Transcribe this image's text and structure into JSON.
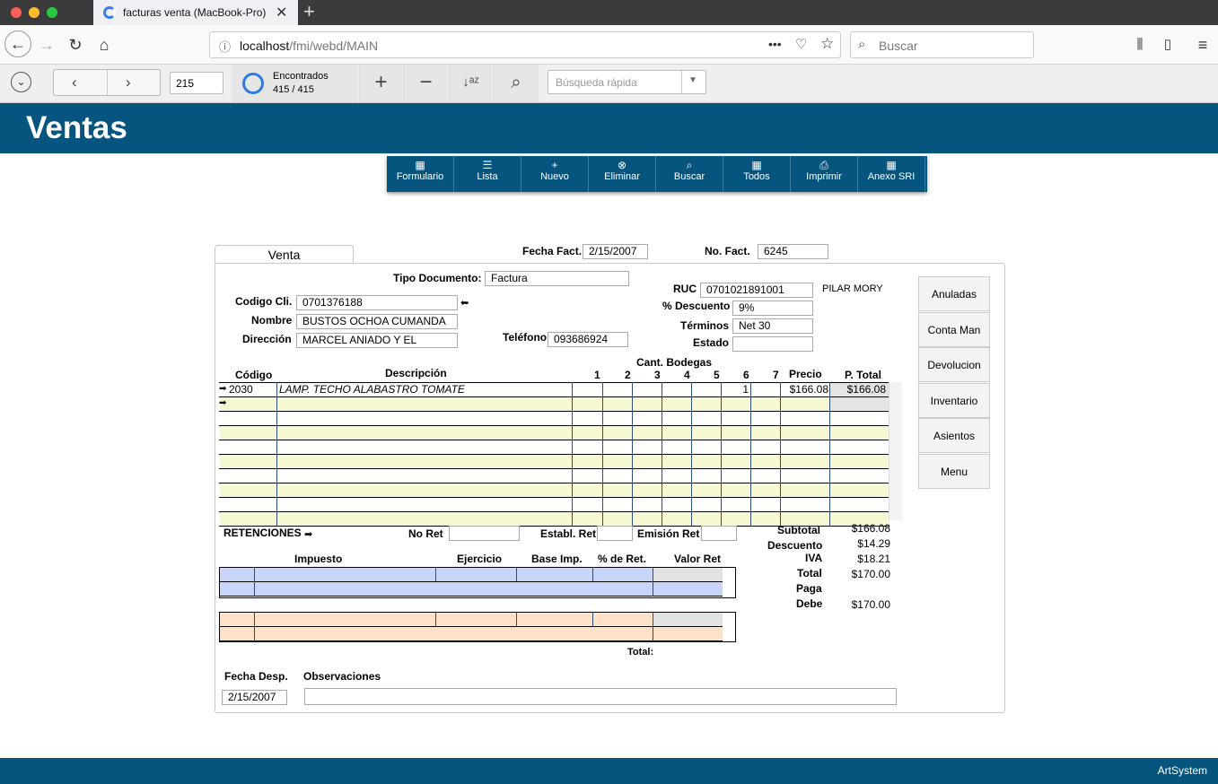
{
  "browser": {
    "tab_title": "facturas venta (MacBook-Pro)",
    "url_host": "localhost",
    "url_path": "/fmi/webd/MAIN",
    "search_placeholder": "Buscar"
  },
  "fm_toolbar": {
    "record_number": "215",
    "found_label": "Encontrados",
    "found_count": "415 / 415",
    "quick_search_placeholder": "Búsqueda rápida"
  },
  "header": {
    "title": "Ventas"
  },
  "footer": {
    "brand": "ArtSystem"
  },
  "actions": [
    {
      "label": "Formulario",
      "icon": "▦"
    },
    {
      "label": "Lista",
      "icon": "☰"
    },
    {
      "label": "Nuevo",
      "icon": "+"
    },
    {
      "label": "Eliminar",
      "icon": "⊗"
    },
    {
      "label": "Buscar",
      "icon": "⌕"
    },
    {
      "label": "Todos",
      "icon": "▦"
    },
    {
      "label": "Imprimir",
      "icon": "⎙"
    },
    {
      "label": "Anexo SRI",
      "icon": "▦"
    }
  ],
  "form": {
    "tab_label": "Venta",
    "fecha_fact_label": "Fecha Fact.",
    "fecha_fact": "2/15/2007",
    "no_fact_label": "No. Fact.",
    "no_fact": "6245",
    "tipo_doc_label": "Tipo Documento:",
    "tipo_doc": "Factura",
    "codigo_cli_label": "Codigo Cli.",
    "codigo_cli": "0701376188",
    "nombre_label": "Nombre",
    "nombre": "BUSTOS OCHOA CUMANDA",
    "direccion_label": "Dirección",
    "direccion": "MARCEL ANIADO Y EL",
    "telefono_label": "Teléfono",
    "telefono": "093686924",
    "ruc_label": "RUC",
    "ruc": "0701021891001",
    "vendedor": "PILAR MORY",
    "descuento_label": "% Descuento",
    "descuento": "9%",
    "terminos_label": "Términos",
    "terminos": "Net 30",
    "estado_label": "Estado",
    "estado": ""
  },
  "side_buttons": [
    "Anuladas",
    "Conta Man",
    "Devolucion",
    "Inventario",
    "Asientos",
    "Menu"
  ],
  "items_header": {
    "codigo": "Código",
    "descripcion": "Descripción",
    "bodegas": "Cant. Bodegas",
    "cols": [
      "1",
      "2",
      "3",
      "4",
      "5",
      "6",
      "7"
    ],
    "precio": "Precio",
    "ptotal": "P. Total"
  },
  "items": [
    {
      "codigo": "2030",
      "descripcion": "LAMP. TECHO ALABASTRO TOMATE",
      "bodega6": "1",
      "precio": "$166.08",
      "total": "$166.08"
    }
  ],
  "retenciones": {
    "title": "RETENCIONES",
    "no_ret_label": "No  Ret",
    "establ_label": "Establ. Ret",
    "emision_label": "Emisión Ret",
    "cols": [
      "Impuesto",
      "Ejercicio",
      "Base Imp.",
      "% de Ret.",
      "Valor Ret"
    ],
    "total_label": "Total:"
  },
  "totals": {
    "subtotal_label": "Subtotal",
    "subtotal": "$166.08",
    "descuento_label": "Descuento",
    "descuento": "$14.29",
    "iva_label": "IVA",
    "iva": "$18.21",
    "total_label": "Total",
    "total": "$170.00",
    "paga_label": "Paga",
    "paga": "",
    "debe_label": "Debe",
    "debe": "$170.00"
  },
  "bottom": {
    "fecha_desp_label": "Fecha Desp.",
    "fecha_desp": "2/15/2007",
    "observaciones_label": "Observaciones",
    "observaciones": ""
  }
}
